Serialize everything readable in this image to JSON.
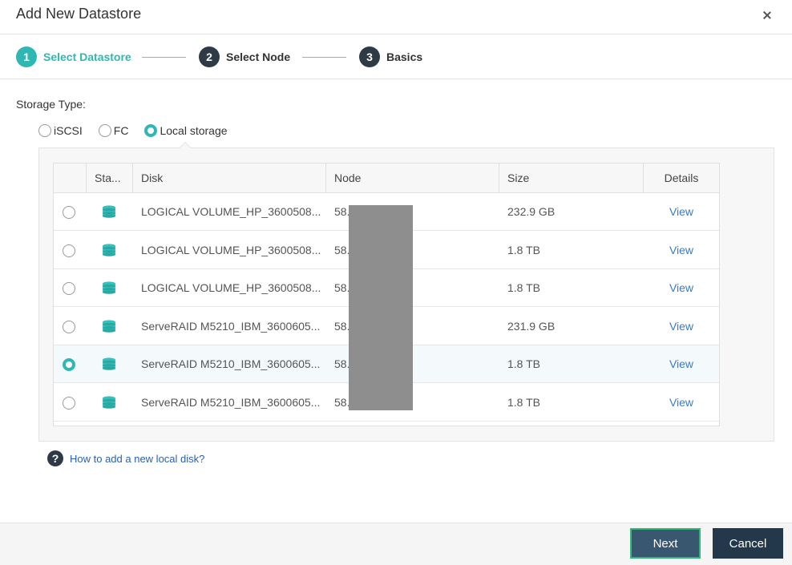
{
  "dialog": {
    "title": "Add New Datastore"
  },
  "steps": [
    {
      "num": "1",
      "label": "Select Datastore",
      "active": true
    },
    {
      "num": "2",
      "label": "Select Node",
      "active": false
    },
    {
      "num": "3",
      "label": "Basics",
      "active": false
    }
  ],
  "storage": {
    "label": "Storage Type:",
    "options": [
      {
        "label": "iSCSI",
        "selected": false
      },
      {
        "label": "FC",
        "selected": false
      },
      {
        "label": "Local storage",
        "selected": true
      }
    ]
  },
  "table": {
    "columns": [
      "Sta...",
      "Disk",
      "Node",
      "Size",
      "Details"
    ],
    "rows": [
      {
        "disk": "LOGICAL VOLUME_HP_3600508...",
        "node": "58.",
        "size": "232.9 GB",
        "details": "View",
        "selected": false
      },
      {
        "disk": "LOGICAL VOLUME_HP_3600508...",
        "node": "58.",
        "size": "1.8 TB",
        "details": "View",
        "selected": false
      },
      {
        "disk": "LOGICAL VOLUME_HP_3600508...",
        "node": "58.",
        "size": "1.8 TB",
        "details": "View",
        "selected": false
      },
      {
        "disk": "ServeRAID M5210_IBM_3600605...",
        "node": "58.",
        "size": "231.9 GB",
        "details": "View",
        "selected": false
      },
      {
        "disk": "ServeRAID M5210_IBM_3600605...",
        "node": "58.",
        "size": "1.8 TB",
        "details": "View",
        "selected": true
      },
      {
        "disk": "ServeRAID M5210_IBM_3600605...",
        "node": "58.",
        "size": "1.8 TB",
        "details": "View",
        "selected": false
      }
    ]
  },
  "help": {
    "icon": "question-icon",
    "symbol": "?",
    "text": "How to add a new local disk?"
  },
  "footer": {
    "next_label": "Next",
    "cancel_label": "Cancel"
  },
  "colors": {
    "accent": "#2fb8b3",
    "dark": "#2e3b47",
    "link": "#3a7bbf"
  }
}
